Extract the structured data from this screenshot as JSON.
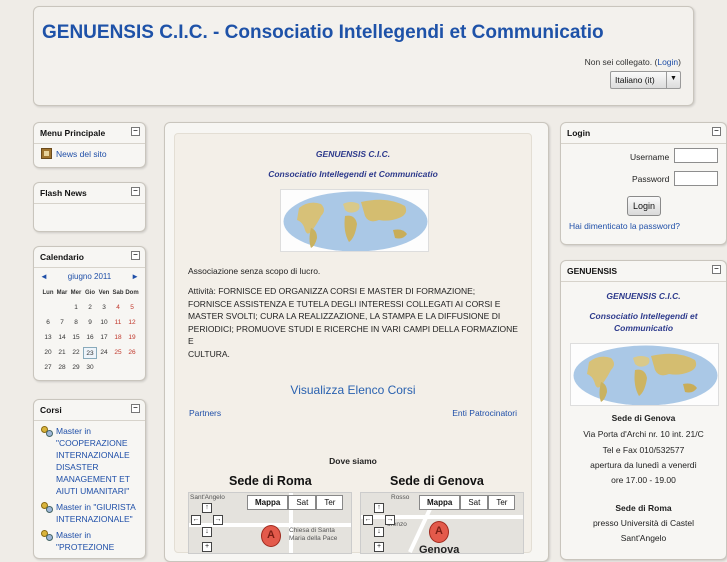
{
  "header": {
    "title": "GENUENSIS C.I.C. - Consociatio Intellegendi et Communicatio",
    "login_prefix": "Non sei collegato. (",
    "login_link": "Login",
    "login_suffix": ")",
    "language": "Italiano (it)"
  },
  "menu_block": {
    "title": "Menu Principale",
    "items": [
      {
        "label": "News del sito",
        "icon": "news-icon"
      }
    ]
  },
  "news_block": {
    "title": "Flash News"
  },
  "calendar": {
    "title": "Calendario",
    "prev": "◄",
    "next": "►",
    "month": "giugno 2011",
    "days_of_week": [
      "Lun",
      "Mar",
      "Mer",
      "Gio",
      "Ven",
      "Sab",
      "Dom"
    ],
    "weeks": [
      [
        "",
        "",
        "1",
        "2",
        "3",
        "4",
        "5"
      ],
      [
        "6",
        "7",
        "8",
        "9",
        "10",
        "11",
        "12"
      ],
      [
        "13",
        "14",
        "15",
        "16",
        "17",
        "18",
        "19"
      ],
      [
        "20",
        "21",
        "22",
        "23",
        "24",
        "25",
        "26"
      ],
      [
        "27",
        "28",
        "29",
        "30",
        "",
        "",
        ""
      ]
    ],
    "today": "23"
  },
  "corsi_block": {
    "title": "Corsi",
    "items": [
      "Master in \"COOPERAZIONE INTERNAZIONALE DISASTER MANAGEMENT ET AIUTI UMANITARI\"",
      "Master in \"GIURISTA INTERNAZIONALE\"",
      "Master in \"PROTEZIONE"
    ]
  },
  "main": {
    "org_name": "GENUENSIS C.I.C.",
    "org_subtitle": "Consociatio Intellegendi et Communicatio",
    "association_text": "Associazione senza scopo di lucro.",
    "activity_lines": [
      "Attività: FORNISCE ED ORGANIZZA CORSI E MASTER DI FORMAZIONE;",
      "FORNISCE ASSISTENZA E TUTELA DEGLI INTERESSI COLLEGATI AI CORSI E",
      "MASTER SVOLTI; CURA LA REALIZZAZIONE, LA STAMPA E LA DIFFUSIONE DI",
      "PERIODICI; PROMUOVE STUDI E RICERCHE IN VARI CAMPI DELLA FORMAZIONE E",
      "CULTURA."
    ],
    "courses_link": "Visualizza Elenco Corsi",
    "partners_link": "Partners",
    "sponsors_link": "Enti Patrocinatori",
    "where_label": "Dove siamo",
    "map_rome_title": "Sede di Roma",
    "map_genoa_title": "Sede di Genova",
    "map_types": [
      "Mappa",
      "Sat",
      "Ter"
    ],
    "rome_map_labels": [
      "Sant'Angelo",
      "Chiesa di Santa",
      "Maria della Pace"
    ],
    "genoa_map_labels": [
      "Rosso",
      "orenzo",
      "Genova"
    ],
    "pin_label": "A"
  },
  "login_block": {
    "title": "Login",
    "username_label": "Username",
    "password_label": "Password",
    "button": "Login",
    "forgot_link": "Hai dimenticato la password?"
  },
  "genuensis_block": {
    "title": "GENUENSIS",
    "org_name": "GENUENSIS C.I.C.",
    "org_subtitle_1": "Consociatio Intellegendi et",
    "org_subtitle_2": "Communicatio",
    "genoa_heading": "Sede di Genova",
    "genoa_lines": [
      "Via Porta d'Archi nr. 10 int. 21/C",
      "Tel e Fax 010/532577",
      "apertura da lunedì a venerdì",
      "ore 17.00 - 19.00"
    ],
    "rome_heading": "Sede di Roma",
    "rome_lines": [
      "presso Università di Castel",
      "Sant'Angelo"
    ]
  },
  "colors": {
    "title_blue": "#1e52a8",
    "link_blue": "#1f4fa8",
    "weekend_red": "#c0372b"
  }
}
